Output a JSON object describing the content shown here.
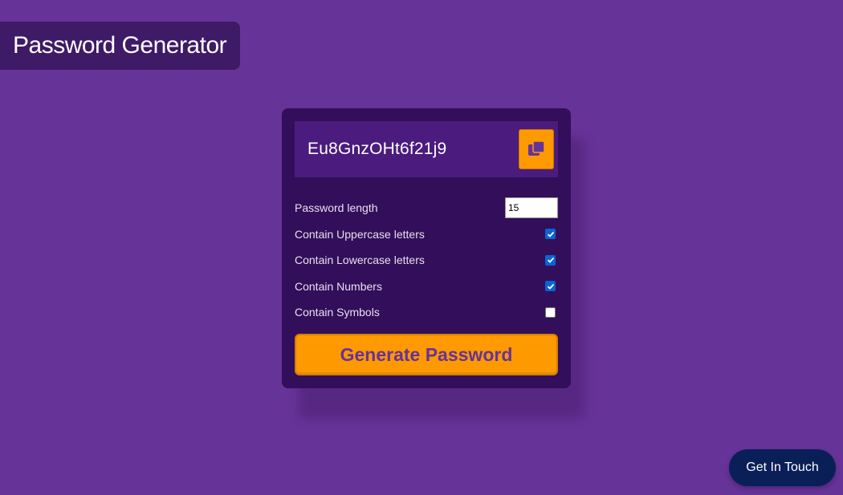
{
  "app": {
    "title": "Password Generator"
  },
  "result": {
    "password": "Eu8GnzOHt6f21j9",
    "copy_icon": "copy-icon"
  },
  "settings": [
    {
      "label": "Password length",
      "type": "number",
      "value": "15"
    },
    {
      "label": "Contain Uppercase letters",
      "type": "checkbox",
      "checked": true
    },
    {
      "label": "Contain Lowercase letters",
      "type": "checkbox",
      "checked": true
    },
    {
      "label": "Contain Numbers",
      "type": "checkbox",
      "checked": true
    },
    {
      "label": "Contain Symbols",
      "type": "checkbox",
      "checked": false
    }
  ],
  "generate": {
    "label": "Generate Password"
  },
  "contact": {
    "label": "Get In Touch"
  },
  "colors": {
    "background": "#663399",
    "card": "#330e5a",
    "accent": "#ff9900",
    "contact_button": "#0a1f57"
  }
}
